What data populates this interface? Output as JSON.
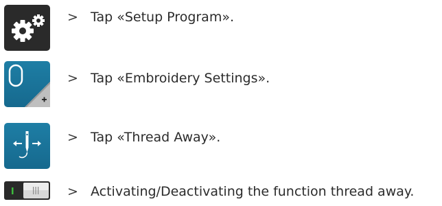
{
  "steps": [
    {
      "marker": ">",
      "text": "Tap «Setup Program».",
      "icon": "setup-program-gears-icon",
      "icon_bg": "#2a2a2a"
    },
    {
      "marker": ">",
      "text": "Tap «Embroidery Settings».",
      "icon": "embroidery-settings-hoop-icon",
      "icon_bg": "#1a739a"
    },
    {
      "marker": ">",
      "text": "Tap «Thread Away».",
      "icon": "thread-away-needle-icon",
      "icon_bg": "#1a739a"
    },
    {
      "marker": ">",
      "text": "Activating/Deactivating the function thread away.",
      "icon": "toggle-switch-icon",
      "icon_bg": "#2a2a2a"
    }
  ]
}
